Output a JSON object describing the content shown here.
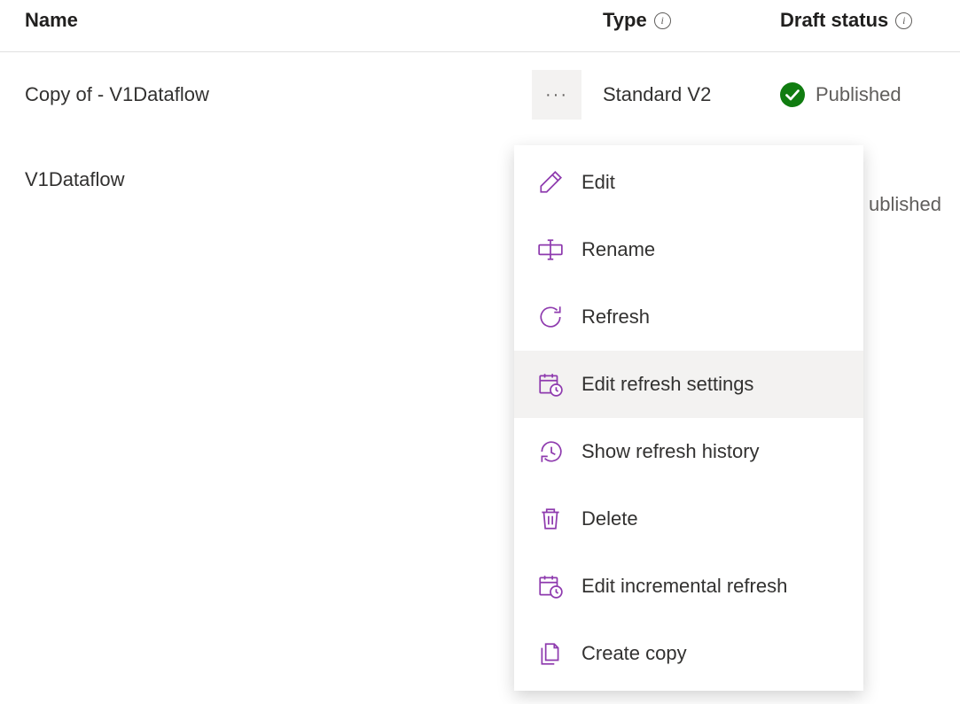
{
  "columns": {
    "name": "Name",
    "type": "Type",
    "status": "Draft status"
  },
  "rows": [
    {
      "name": "Copy of - V1Dataflow",
      "type": "Standard V2",
      "status": "Published",
      "show_actions": true
    },
    {
      "name": "V1Dataflow",
      "type": "",
      "status": "",
      "show_actions": false
    }
  ],
  "hidden_status_fragment": "ublished",
  "menu": {
    "items": [
      {
        "label": "Edit",
        "icon": "edit",
        "hovered": false
      },
      {
        "label": "Rename",
        "icon": "rename",
        "hovered": false
      },
      {
        "label": "Refresh",
        "icon": "refresh",
        "hovered": false
      },
      {
        "label": "Edit refresh settings",
        "icon": "schedule",
        "hovered": true
      },
      {
        "label": "Show refresh history",
        "icon": "history",
        "hovered": false
      },
      {
        "label": "Delete",
        "icon": "delete",
        "hovered": false
      },
      {
        "label": "Edit incremental refresh",
        "icon": "schedule",
        "hovered": false
      },
      {
        "label": "Create copy",
        "icon": "copy",
        "hovered": false
      }
    ]
  }
}
